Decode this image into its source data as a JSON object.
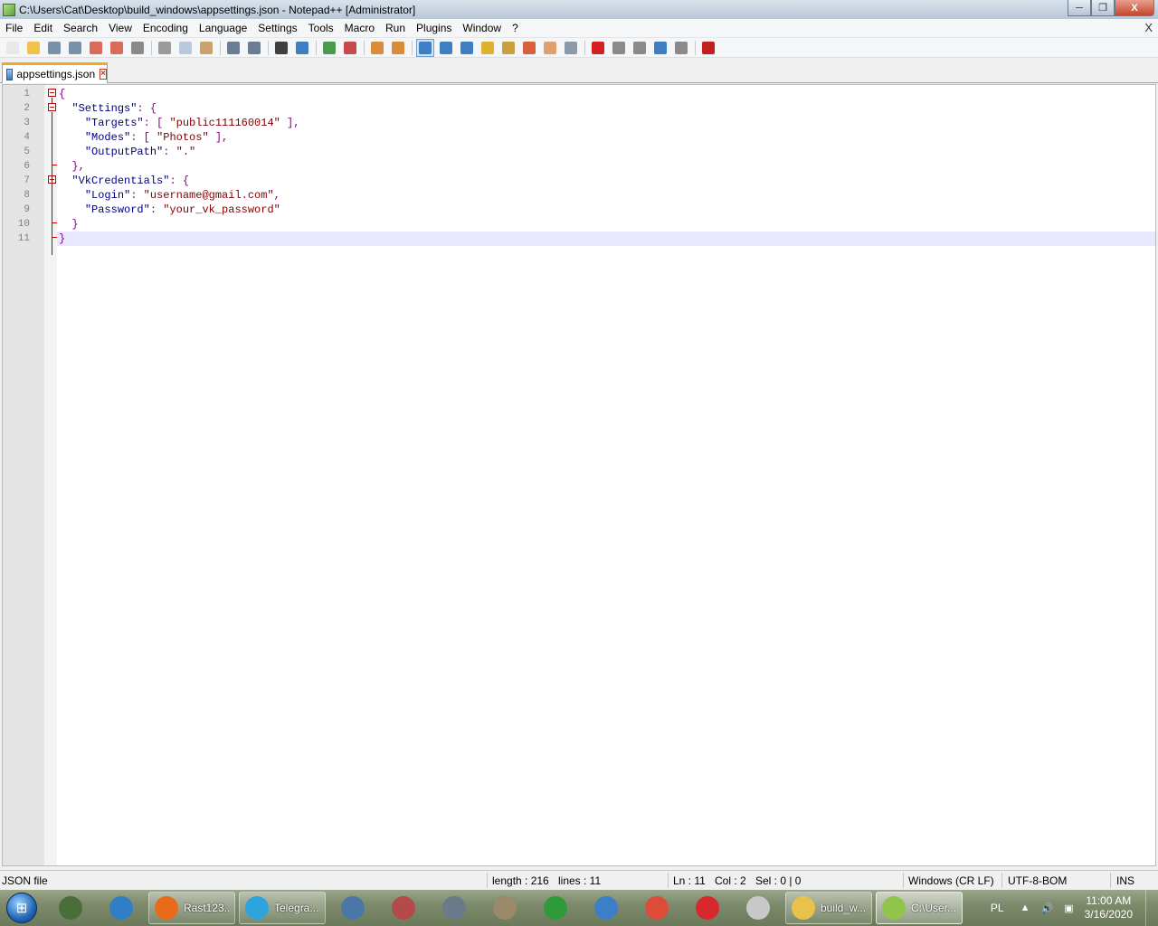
{
  "window": {
    "title": "C:\\Users\\Cat\\Desktop\\build_windows\\appsettings.json - Notepad++ [Administrator]",
    "minimize_glyph": "─",
    "maximize_glyph": "❐",
    "close_glyph": "X"
  },
  "menu": {
    "items": [
      "File",
      "Edit",
      "Search",
      "View",
      "Encoding",
      "Language",
      "Settings",
      "Tools",
      "Macro",
      "Run",
      "Plugins",
      "Window",
      "?"
    ],
    "close_doc": "X"
  },
  "toolbar": {
    "buttons": [
      {
        "name": "new-file-icon",
        "color": "#e8e8e8"
      },
      {
        "name": "open-file-icon",
        "color": "#f0c24a"
      },
      {
        "name": "save-icon",
        "color": "#7a8fa8"
      },
      {
        "name": "save-all-icon",
        "color": "#7a8fa8"
      },
      {
        "name": "close-icon",
        "color": "#d96b5a"
      },
      {
        "name": "close-all-icon",
        "color": "#d96b5a"
      },
      {
        "name": "print-icon",
        "color": "#8a8a8a"
      },
      {
        "name": "cut-icon",
        "color": "#9a9a9a"
      },
      {
        "name": "copy-icon",
        "color": "#b9c8da"
      },
      {
        "name": "paste-icon",
        "color": "#c9a36a"
      },
      {
        "name": "undo-icon",
        "color": "#6b7d93"
      },
      {
        "name": "redo-icon",
        "color": "#6b7d93"
      },
      {
        "name": "find-icon",
        "color": "#404040"
      },
      {
        "name": "replace-icon",
        "color": "#3d7fc2"
      },
      {
        "name": "zoom-in-icon",
        "color": "#4a9c4a"
      },
      {
        "name": "zoom-out-icon",
        "color": "#c94a4a"
      },
      {
        "name": "sync-vertical-icon",
        "color": "#d98c3a"
      },
      {
        "name": "sync-horizontal-icon",
        "color": "#d98c3a"
      },
      {
        "name": "word-wrap-icon",
        "color": "#3d7fc2"
      },
      {
        "name": "show-all-chars-icon",
        "color": "#3d7fc2"
      },
      {
        "name": "indent-guide-icon",
        "color": "#3d7fc2"
      },
      {
        "name": "udl-icon",
        "color": "#e0b030"
      },
      {
        "name": "doc-map-icon",
        "color": "#c8a040"
      },
      {
        "name": "function-list-icon",
        "color": "#d9603a"
      },
      {
        "name": "folder-workspace-icon",
        "color": "#e0a070"
      },
      {
        "name": "monitoring-icon",
        "color": "#8a9aaa"
      },
      {
        "name": "record-macro-icon",
        "color": "#d42020"
      },
      {
        "name": "stop-macro-icon",
        "color": "#8a8a8a"
      },
      {
        "name": "play-macro-icon",
        "color": "#8a8a8a"
      },
      {
        "name": "run-macro-multiple-icon",
        "color": "#3d7fc2"
      },
      {
        "name": "save-macro-icon",
        "color": "#8a8a8a"
      },
      {
        "name": "spell-check-icon",
        "color": "#c02020"
      }
    ]
  },
  "tab": {
    "label": "appsettings.json"
  },
  "editor": {
    "lines": [
      {
        "n": "1",
        "parts": [
          [
            "p",
            "{"
          ]
        ]
      },
      {
        "n": "2",
        "parts": [
          [
            "t",
            "  "
          ],
          [
            "k",
            "\"Settings\""
          ],
          [
            "p",
            ": {"
          ]
        ]
      },
      {
        "n": "3",
        "parts": [
          [
            "t",
            "    "
          ],
          [
            "k",
            "\"Targets\""
          ],
          [
            "p",
            ": [ "
          ],
          [
            "s",
            "\"public111160014\""
          ],
          [
            "p",
            " ],"
          ]
        ]
      },
      {
        "n": "4",
        "parts": [
          [
            "t",
            "    "
          ],
          [
            "k",
            "\"Modes\""
          ],
          [
            "p",
            ": [ "
          ],
          [
            "s",
            "\"Photos\""
          ],
          [
            "p",
            " ],"
          ]
        ]
      },
      {
        "n": "5",
        "parts": [
          [
            "t",
            "    "
          ],
          [
            "k",
            "\"OutputPath\""
          ],
          [
            "p",
            ": "
          ],
          [
            "s",
            "\".\""
          ]
        ]
      },
      {
        "n": "6",
        "parts": [
          [
            "t",
            "  "
          ],
          [
            "p",
            "},"
          ]
        ]
      },
      {
        "n": "7",
        "parts": [
          [
            "t",
            "  "
          ],
          [
            "k",
            "\"VkCredentials\""
          ],
          [
            "p",
            ": {"
          ]
        ]
      },
      {
        "n": "8",
        "parts": [
          [
            "t",
            "    "
          ],
          [
            "k",
            "\"Login\""
          ],
          [
            "p",
            ": "
          ],
          [
            "s",
            "\"username@gmail.com\""
          ],
          [
            "p",
            ","
          ]
        ]
      },
      {
        "n": "9",
        "parts": [
          [
            "t",
            "    "
          ],
          [
            "k",
            "\"Password\""
          ],
          [
            "p",
            ": "
          ],
          [
            "s",
            "\"your_vk_password\""
          ]
        ]
      },
      {
        "n": "10",
        "parts": [
          [
            "t",
            "  "
          ],
          [
            "p",
            "}"
          ]
        ]
      },
      {
        "n": "11",
        "parts": [
          [
            "p",
            "}"
          ]
        ]
      }
    ],
    "current_line": 11
  },
  "status": {
    "file_type": "JSON file",
    "length": "length : 216",
    "lines": "lines : 11",
    "ln": "Ln : 11",
    "col": "Col : 2",
    "sel": "Sel : 0 | 0",
    "eol": "Windows (CR LF)",
    "encoding": "UTF-8-BOM",
    "mode": "INS"
  },
  "taskbar": {
    "start_glyph": "⊞",
    "items": [
      {
        "name": "task-manager-taskbar-item",
        "label": "",
        "color": "#4a6e3a",
        "kind": "pinned"
      },
      {
        "name": "browser-taskbar-item",
        "label": "",
        "color": "#2f7ec7",
        "kind": "pinned"
      },
      {
        "name": "firefox-taskbar-item",
        "label": "Rast123...",
        "color": "#e86a1a",
        "kind": "open"
      },
      {
        "name": "telegram-taskbar-item",
        "label": "Telegra...",
        "color": "#2ea4dd",
        "kind": "open"
      },
      {
        "name": "vk-taskbar-item",
        "label": "",
        "color": "#4a76a8",
        "kind": "pinned"
      },
      {
        "name": "scissors-taskbar-item",
        "label": "",
        "color": "#b54a4a",
        "kind": "pinned"
      },
      {
        "name": "lambda-taskbar-item",
        "label": "",
        "color": "#6a7a8a",
        "kind": "pinned"
      },
      {
        "name": "archive-taskbar-item",
        "label": "",
        "color": "#9a8a6a",
        "kind": "pinned"
      },
      {
        "name": "download-taskbar-item",
        "label": "",
        "color": "#2e9a3a",
        "kind": "pinned"
      },
      {
        "name": "qbittorrent-taskbar-item",
        "label": "",
        "color": "#3c7fc8",
        "kind": "pinned"
      },
      {
        "name": "chrome-taskbar-item",
        "label": "",
        "color": "#dd4b39",
        "kind": "pinned"
      },
      {
        "name": "mega-taskbar-item",
        "label": "",
        "color": "#d9272e",
        "kind": "pinned"
      },
      {
        "name": "clock-app-taskbar-item",
        "label": "",
        "color": "#c8c8c8",
        "kind": "pinned"
      },
      {
        "name": "explorer-taskbar-item",
        "label": "build_w...",
        "color": "#e8c24a",
        "kind": "open"
      },
      {
        "name": "notepadpp-taskbar-item",
        "label": "C:\\User...",
        "color": "#8ec54a",
        "kind": "active"
      }
    ],
    "language": "PL",
    "tray_arrow": "▲",
    "volume_glyph": "🔊",
    "network_glyph": "▣",
    "time": "11:00 AM",
    "date": "3/16/2020"
  }
}
